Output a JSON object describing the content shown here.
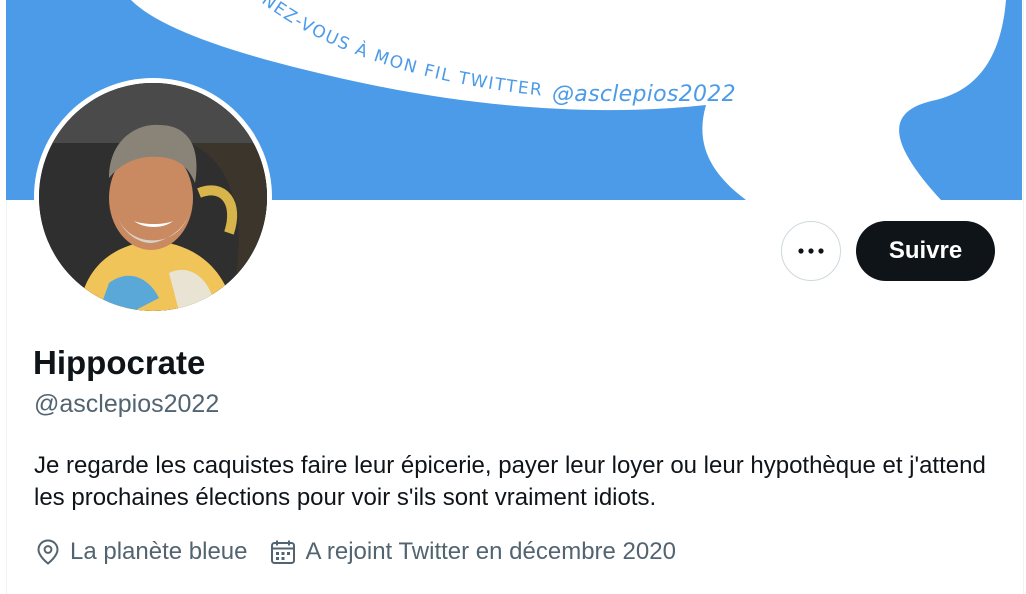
{
  "banner": {
    "curved_text": "NEZ-VOUS À MON FIL TWITTER",
    "handle": "@asclepios2022",
    "colors": {
      "background": "#4b9be8",
      "shape": "#ffffff",
      "text": "#4b9be8"
    }
  },
  "avatar": {
    "alt": "Photo de profil",
    "icon": "avatar-photo"
  },
  "actions": {
    "more_icon": "more-horizontal-icon",
    "follow_label": "Suivre"
  },
  "profile": {
    "name": "Hippocrate",
    "handle": "@asclepios2022",
    "bio": "Je regarde les caquistes faire leur épicerie, payer leur loyer ou leur hypothèque et j'attend les prochaines élections pour voir s'ils sont vraiment idiots.",
    "location": "La planète bleue",
    "location_icon": "location-pin-icon",
    "joined": "A rejoint Twitter en décembre 2020",
    "joined_icon": "calendar-icon"
  },
  "colors": {
    "text_primary": "#0f1419",
    "text_secondary": "#536471",
    "button_dark": "#0f1419"
  }
}
